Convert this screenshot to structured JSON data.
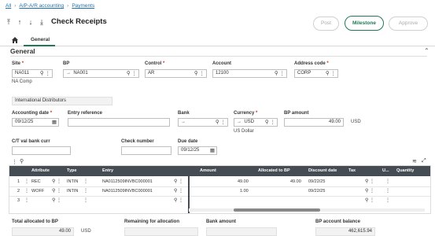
{
  "breadcrumb": {
    "items": [
      "All",
      "A/P-A/R accounting",
      "Payments"
    ]
  },
  "header": {
    "title": "Check Receipts"
  },
  "actions": {
    "post": "Post",
    "milestone": "Milestone",
    "approve": "Approve"
  },
  "tabs": {
    "general": "General"
  },
  "section": {
    "title": "General"
  },
  "form": {
    "site": {
      "label": "Site",
      "value": "NA011",
      "sub": "NA Comp"
    },
    "bp": {
      "label": "BP",
      "value": "NA001"
    },
    "control": {
      "label": "Control",
      "value": "AR"
    },
    "account": {
      "label": "Account",
      "value": "12100"
    },
    "address_code": {
      "label": "Address code",
      "value": "CORP"
    },
    "bp_name": {
      "value": "International Distributors"
    },
    "accounting_date": {
      "label": "Accounting date",
      "value": "09/12/25"
    },
    "entry_reference": {
      "label": "Entry reference",
      "value": ""
    },
    "bank": {
      "label": "Bank",
      "value": ""
    },
    "currency": {
      "label": "Currency",
      "value": "USD",
      "sub": "US Dollar"
    },
    "bp_amount": {
      "label": "BP amount",
      "value": "49.00",
      "unit": "USD"
    },
    "ct_val": {
      "label": "C/T val bank curr",
      "value": ""
    },
    "check_number": {
      "label": "Check number",
      "value": ""
    },
    "due_date": {
      "label": "Due date",
      "value": "09/12/25"
    }
  },
  "grid": {
    "columns": {
      "attribute": "Attribute",
      "type": "Type",
      "entry": "Entry",
      "amount": "Amount",
      "allocated": "Allocated to BP",
      "discount_date": "Discount date",
      "tax": "Tax",
      "u": "U...",
      "quantity": "Quantity"
    },
    "rows": [
      {
        "num": "1",
        "attribute": "REC",
        "type": "INTIN",
        "entry": "NA0112509INVBC000001",
        "amount": "49.00",
        "allocated": "49.00",
        "discount_date": "09/22/25"
      },
      {
        "num": "2",
        "attribute": "WOFF",
        "type": "INTIN",
        "entry": "NA0112509INVBC000001",
        "amount": "1.00",
        "allocated": "",
        "discount_date": "09/22/25"
      },
      {
        "num": "3",
        "attribute": "",
        "type": "",
        "entry": "",
        "amount": "",
        "allocated": "",
        "discount_date": ""
      }
    ]
  },
  "totals": {
    "total_allocated": {
      "label": "Total allocated to BP",
      "value": "49.00",
      "unit": "USD"
    },
    "remaining": {
      "label": "Remaining for allocation",
      "value": ""
    },
    "bank_amount": {
      "label": "Bank amount",
      "value": ""
    },
    "bp_balance": {
      "label": "BP account balance",
      "value": "462,615.94"
    }
  },
  "colors": {
    "accent": "#1f7a54",
    "link": "#1a6fb0",
    "grid_header": "#454c54",
    "required": "#c0392b"
  },
  "icons": [
    "pin-icon",
    "up-icon",
    "down-icon",
    "down-to-bottom-icon",
    "home-icon",
    "search-icon",
    "more-icon",
    "calendar-icon",
    "arrow-right-icon",
    "layers-icon",
    "expand-icon"
  ]
}
